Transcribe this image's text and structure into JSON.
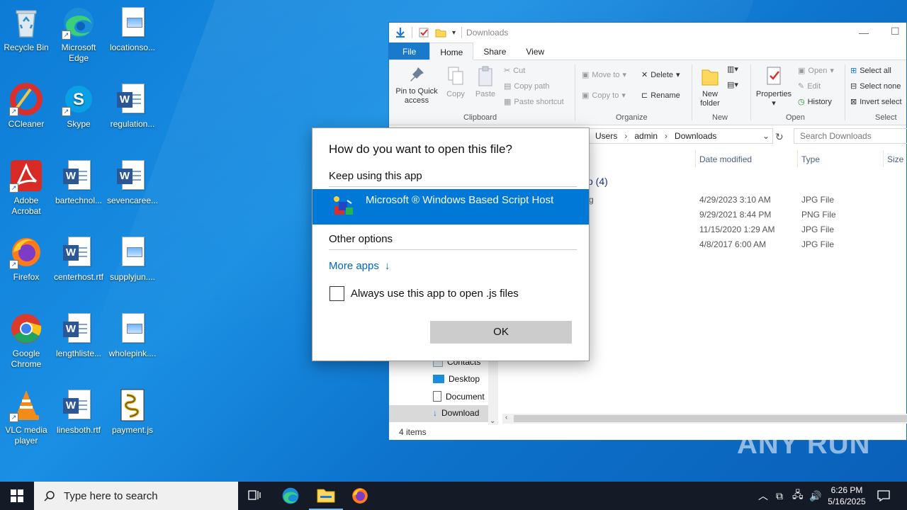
{
  "desktop": {
    "icons": [
      {
        "label": "Recycle Bin",
        "icon": "recycle-bin-icon"
      },
      {
        "label": "Microsoft Edge",
        "icon": "edge-icon"
      },
      {
        "label": "locationso...",
        "icon": "image-file-icon"
      },
      {
        "label": "CCleaner",
        "icon": "ccleaner-icon"
      },
      {
        "label": "Skype",
        "icon": "skype-icon"
      },
      {
        "label": "regulation...",
        "icon": "word-doc-icon"
      },
      {
        "label": "Adobe Acrobat",
        "icon": "acrobat-icon"
      },
      {
        "label": "bartechnol...",
        "icon": "word-doc-icon"
      },
      {
        "label": "sevencaree...",
        "icon": "word-doc-icon"
      },
      {
        "label": "Firefox",
        "icon": "firefox-icon"
      },
      {
        "label": "centerhost.rtf",
        "icon": "word-doc-icon"
      },
      {
        "label": "supplyjun....",
        "icon": "image-file-icon"
      },
      {
        "label": "Google Chrome",
        "icon": "chrome-icon"
      },
      {
        "label": "lengthliste...",
        "icon": "word-doc-icon"
      },
      {
        "label": "wholepink....",
        "icon": "image-file-icon"
      },
      {
        "label": "VLC media player",
        "icon": "vlc-icon"
      },
      {
        "label": "linesboth.rtf",
        "icon": "word-doc-icon"
      },
      {
        "label": "payment.js",
        "icon": "script-file-icon"
      }
    ]
  },
  "explorer": {
    "title": "Downloads",
    "tabs": {
      "file": "File",
      "home": "Home",
      "share": "Share",
      "view": "View"
    },
    "ribbon": {
      "pin": "Pin to Quick access",
      "copy": "Copy",
      "paste": "Paste",
      "cut": "Cut",
      "copy_path": "Copy path",
      "paste_shortcut": "Paste shortcut",
      "clipboard_group": "Clipboard",
      "move_to": "Move to",
      "copy_to": "Copy to",
      "delete": "Delete",
      "rename": "Rename",
      "organize_group": "Organize",
      "new_folder": "New folder",
      "new_group": "New",
      "properties": "Properties",
      "open": "Open",
      "edit": "Edit",
      "history": "History",
      "open_group": "Open",
      "select_all": "Select all",
      "select_none": "Select none",
      "invert_selection": "Invert select",
      "select_group": "Select"
    },
    "breadcrumb": [
      "Users",
      "admin",
      "Downloads"
    ],
    "search_placeholder": "Search Downloads",
    "columns": {
      "date": "Date modified",
      "type": "Type",
      "size": "Size"
    },
    "group_label": "o (4)",
    "files": [
      {
        "name": "g",
        "date": "4/29/2023 3:10 AM",
        "type": "JPG File"
      },
      {
        "name": "",
        "date": "9/29/2021 8:44 PM",
        "type": "PNG File"
      },
      {
        "name": "",
        "date": "11/15/2020 1:29 AM",
        "type": "JPG File"
      },
      {
        "name": "",
        "date": "4/8/2017 6:00 AM",
        "type": "JPG File"
      }
    ],
    "nav": [
      "Contacts",
      "Desktop",
      "Document",
      "Download"
    ],
    "status": "4 items"
  },
  "dialog": {
    "title": "How do you want to open this file?",
    "keep_using": "Keep using this app",
    "app_name": "Microsoft ® Windows Based Script Host",
    "other_options": "Other options",
    "more_apps": "More apps",
    "always_use": "Always use this app to open .js files",
    "ok": "OK"
  },
  "taskbar": {
    "search_placeholder": "Type here to search",
    "time": "6:26 PM",
    "date": "5/16/2025"
  },
  "watermark": "ANY RUN"
}
